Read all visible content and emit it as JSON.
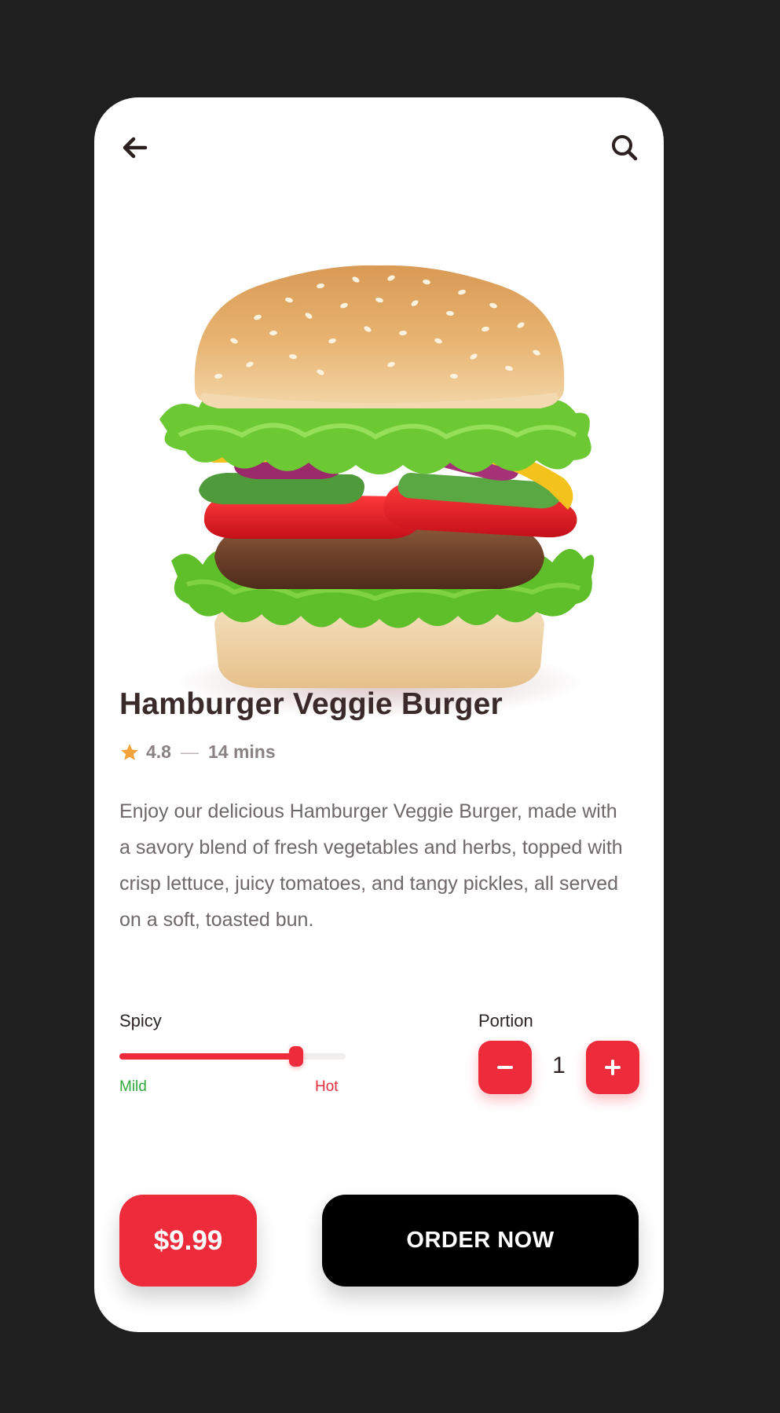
{
  "product": {
    "title": "Hamburger Veggie Burger",
    "rating": "4.8",
    "separator": "—",
    "time": "14 mins",
    "description": "Enjoy our delicious Hamburger Veggie Burger, made with a savory blend of fresh vegetables and herbs, topped with crisp lettuce, juicy tomatoes, and tangy pickles, all served on a soft, toasted bun.",
    "image_icon": "burger-image"
  },
  "header": {
    "back_icon": "arrow-left-icon",
    "search_icon": "search-icon"
  },
  "spicy": {
    "label": "Spicy",
    "min_label": "Mild",
    "max_label": "Hot",
    "level": 0.78
  },
  "portion": {
    "label": "Portion",
    "value": "1",
    "minus_icon": "minus-icon",
    "plus_icon": "plus-icon"
  },
  "footer": {
    "price": "$9.99",
    "order_label": "ORDER NOW"
  },
  "colors": {
    "accent": "#ee2b3b",
    "star": "#f2a33a",
    "mild": "#2eaa3a",
    "dark_button": "#000000",
    "background": "#1f1f1f"
  }
}
